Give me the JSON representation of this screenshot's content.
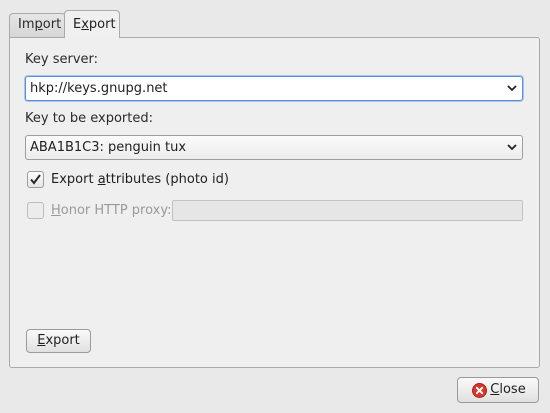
{
  "tabs": [
    {
      "label_pre": "Im",
      "label_u": "p",
      "label_post": "ort",
      "active": false
    },
    {
      "label_pre": "E",
      "label_u": "x",
      "label_post": "port",
      "active": true
    }
  ],
  "key_server": {
    "label": "Key server:",
    "value": "hkp://keys.gnupg.net"
  },
  "key_export": {
    "label": "Key to be exported:",
    "value": "ABA1B1C3: penguin tux"
  },
  "export_attributes": {
    "label_pre": "Export ",
    "label_u": "a",
    "label_post": "ttributes (photo id)",
    "checked": true
  },
  "http_proxy": {
    "label_u": "H",
    "label_post": "onor HTTP proxy:",
    "checked": false,
    "value": ""
  },
  "buttons": {
    "export_u": "E",
    "export_post": "xport",
    "close_u": "C",
    "close_post": "lose"
  },
  "icons": {
    "close": "close-icon",
    "check": "checkmark-icon",
    "dropdown": "chevron-down-icon"
  },
  "colors": {
    "focus": "#5a8fd6",
    "close_icon": "#d9352b"
  }
}
